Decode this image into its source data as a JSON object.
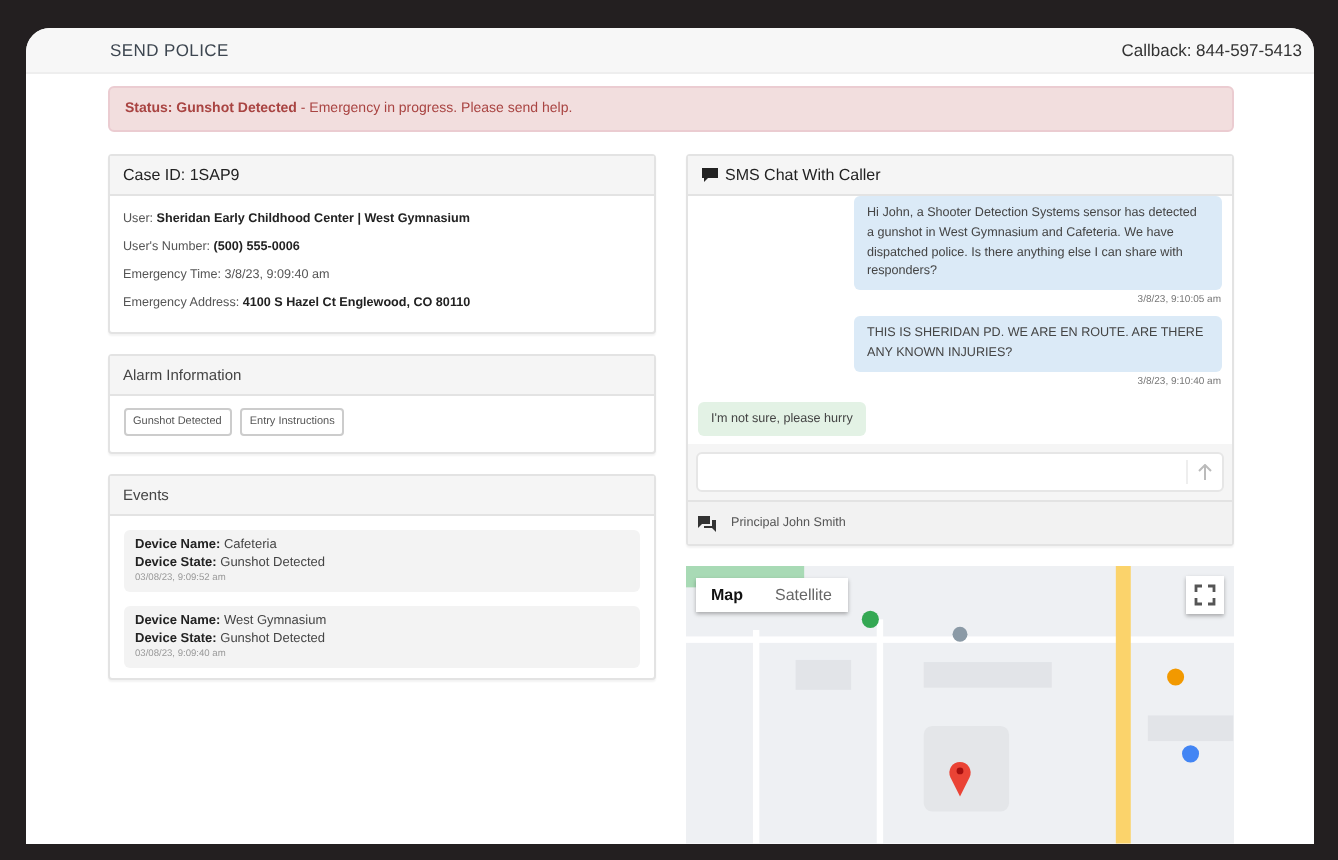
{
  "header": {
    "title": "SEND POLICE",
    "callback": "Callback: 844-597-5413"
  },
  "alert": {
    "text": "**Status: Gunshot Detected** - Emergency in progress. Please send help."
  },
  "case": {
    "title": "Case ID: 1SAP9",
    "fields": [
      {
        "text": "User: **Sheridan Early Childhood Center | West Gymnasium**"
      },
      {
        "text": "User's Number: **(500) 555-0006**"
      },
      {
        "text": "Emergency Time: 3/8/23, 9:09:40 am"
      },
      {
        "text": "Emergency Address: **4100 S Hazel Ct Englewood, CO 80110**"
      }
    ]
  },
  "alarm": {
    "title": "Alarm Information",
    "buttons": [
      "Gunshot Detected",
      "Entry Instructions"
    ]
  },
  "events": {
    "title": "Events",
    "items": [
      {
        "name": "**Device Name:** Cafeteria",
        "state": "**Device State:** Gunshot Detected",
        "time": "03/08/23, 9:09:52 am"
      },
      {
        "name": "**Device Name:** West Gymnasium",
        "state": "**Device State:** Gunshot Detected",
        "time": "03/08/23, 9:09:40 am"
      }
    ]
  },
  "chat": {
    "title": "SMS Chat With Caller",
    "messages": [
      {
        "kind": "outgoing",
        "text": "Hi John, a Shooter Detection Systems sensor has detected a gunshot in West Gymnasium and Cafeteria. We have dispatched police. Is there anything else I can share with responders?",
        "time": "3/8/23, 9:10:05 am"
      },
      {
        "kind": "outgoing",
        "text": "THIS IS SHERIDAN PD. WE ARE EN ROUTE. ARE THERE ANY KNOWN INJURIES?",
        "time": "3/8/23, 9:10:40 am"
      },
      {
        "kind": "incoming",
        "text": "I'm not sure, please hurry"
      }
    ],
    "contact": "Principal John Smith"
  },
  "map": {
    "kind": "picture",
    "tabs": [
      {
        "label": "Map",
        "selected": true
      },
      {
        "label": "Satellite",
        "selected": false
      }
    ]
  }
}
